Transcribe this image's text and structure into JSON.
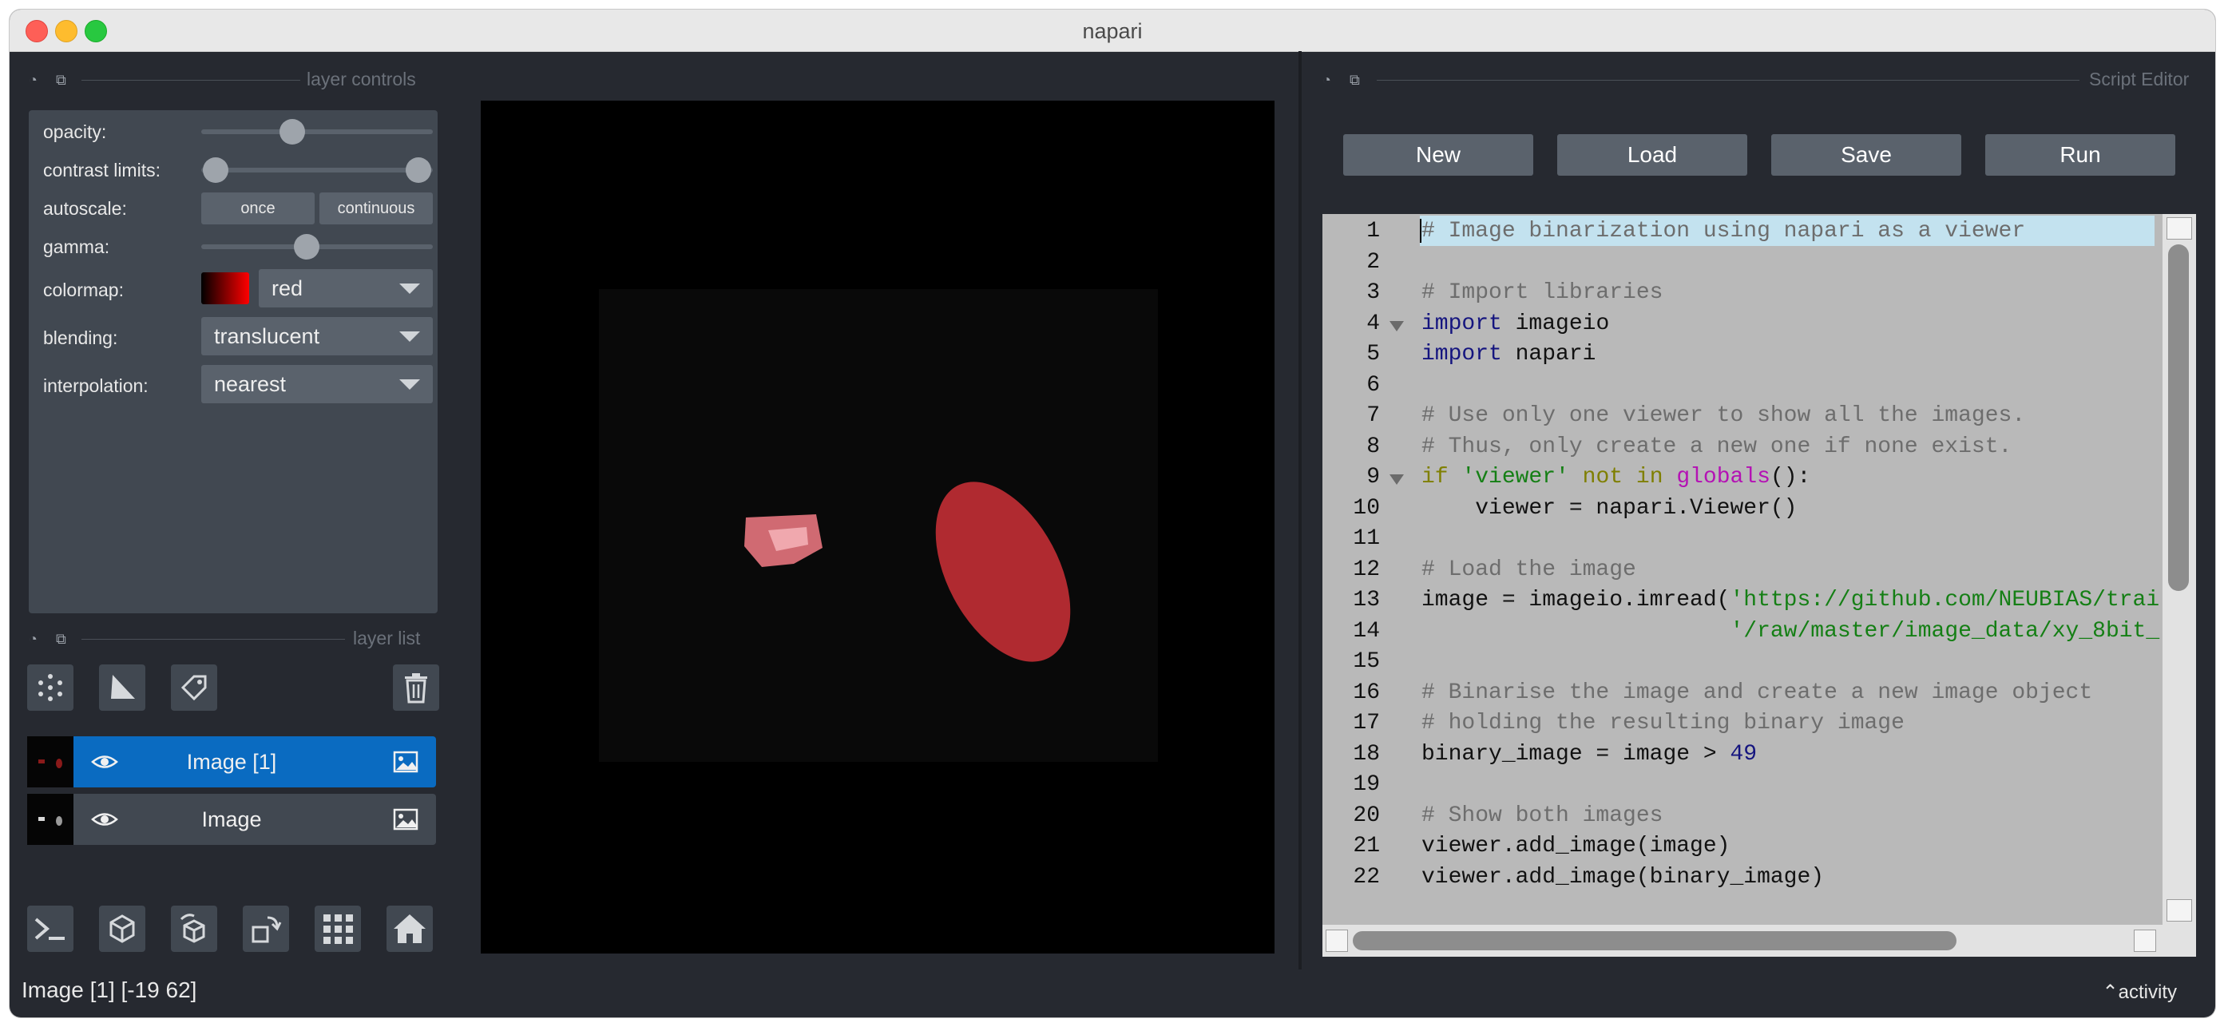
{
  "window": {
    "title": "napari"
  },
  "layer_controls": {
    "title": "layer controls",
    "opacity_label": "opacity:",
    "opacity_value": 0.38,
    "contrast_label": "contrast limits:",
    "contrast_range": [
      0.0,
      1.0
    ],
    "autoscale_label": "autoscale:",
    "autoscale_once": "once",
    "autoscale_continuous": "continuous",
    "gamma_label": "gamma:",
    "gamma_value": 0.45,
    "colormap_label": "colormap:",
    "colormap_value": "red",
    "blending_label": "blending:",
    "blending_value": "translucent",
    "interpolation_label": "interpolation:",
    "interpolation_value": "nearest"
  },
  "layer_list": {
    "title": "layer list",
    "tools": [
      "points-icon",
      "shapes-icon",
      "labels-icon",
      "delete-icon"
    ],
    "layers": [
      {
        "name": "Image [1]",
        "selected": true,
        "visible": true
      },
      {
        "name": "Image",
        "selected": false,
        "visible": true
      }
    ]
  },
  "bottom_toolbar": [
    "console-icon",
    "ndisplay-icon",
    "roll-axes-icon",
    "transpose-icon",
    "grid-icon",
    "home-icon"
  ],
  "status": {
    "text": "Image [1] [-19  62]",
    "activity": "activity"
  },
  "script_editor": {
    "title": "Script Editor",
    "buttons": {
      "new": "New",
      "load": "Load",
      "save": "Save",
      "run": "Run"
    },
    "lines": [
      {
        "n": "1",
        "t": "# Image binarization using napari as a viewer"
      },
      {
        "n": "2",
        "t": ""
      },
      {
        "n": "3",
        "t": "# Import libraries"
      },
      {
        "n": "4",
        "t": "import imageio"
      },
      {
        "n": "5",
        "t": "import napari"
      },
      {
        "n": "6",
        "t": ""
      },
      {
        "n": "7",
        "t": "# Use only one viewer to show all the images."
      },
      {
        "n": "8",
        "t": "# Thus, only create a new one if none exist."
      },
      {
        "n": "9",
        "t": "if 'viewer' not in globals():"
      },
      {
        "n": "10",
        "t": "    viewer = napari.Viewer()"
      },
      {
        "n": "11",
        "t": ""
      },
      {
        "n": "12",
        "t": "# Load the image"
      },
      {
        "n": "13",
        "t": "image = imageio.imread('https://github.com/NEUBIAS/trai"
      },
      {
        "n": "14",
        "t": "                       '/raw/master/image_data/xy_8bit_"
      },
      {
        "n": "15",
        "t": ""
      },
      {
        "n": "16",
        "t": "# Binarise the image and create a new image object"
      },
      {
        "n": "17",
        "t": "# holding the resulting binary image"
      },
      {
        "n": "18",
        "t": "binary_image = image > 49"
      },
      {
        "n": "19",
        "t": ""
      },
      {
        "n": "20",
        "t": "# Show both images"
      },
      {
        "n": "21",
        "t": "viewer.add_image(image)"
      },
      {
        "n": "22",
        "t": "viewer.add_image(binary_image)"
      }
    ]
  },
  "colors": {
    "accent": "#0a6bc1",
    "background": "#262930",
    "panel": "#414851",
    "highlight_line": "#c3e2ef"
  }
}
